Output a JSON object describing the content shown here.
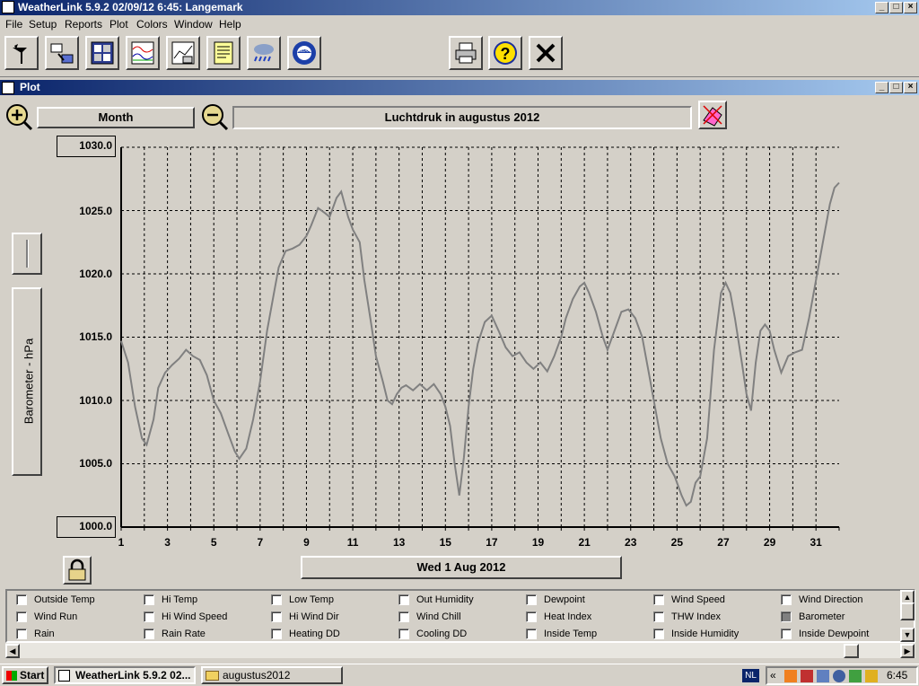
{
  "window": {
    "title": "WeatherLink 5.9.2  02/09/12  6:45: Langemark"
  },
  "menu": [
    "File",
    "Setup",
    "Reports",
    "Plot",
    "Colors",
    "Window",
    "Help"
  ],
  "toolbar": {
    "icons": [
      "station-icon",
      "download-icon",
      "bulletin-icon",
      "strip-chart-icon",
      "plot-icon",
      "summary-icon",
      "rain-icon",
      "noaa-icon",
      "print-icon",
      "help-icon",
      "close-icon"
    ],
    "noaa_label": "NOAA"
  },
  "plot": {
    "window_title": "Plot",
    "span_label": "Month",
    "title": "Luchtdruk in augustus 2012",
    "date_label": "Wed 1 Aug 2012",
    "y_axis_label": "Barometer - hPa",
    "y_max_label": "1030.0",
    "y_min_label": "1000.0",
    "y_ticks": [
      "1025.0",
      "1020.0",
      "1015.0",
      "1010.0",
      "1005.0"
    ],
    "x_ticks": [
      "1",
      "3",
      "5",
      "7",
      "9",
      "11",
      "13",
      "15",
      "17",
      "19",
      "21",
      "23",
      "25",
      "27",
      "29",
      "31"
    ]
  },
  "chart_data": {
    "type": "line",
    "title": "Luchtdruk in augustus 2012",
    "xlabel": "",
    "ylabel": "Barometer - hPa",
    "xlim": [
      1,
      32
    ],
    "ylim": [
      1000,
      1030
    ],
    "grid": true,
    "series": [
      {
        "name": "Barometer",
        "color": "#808080",
        "x": [
          1,
          1.3,
          1.6,
          1.9,
          2.1,
          2.4,
          2.6,
          2.9,
          3.2,
          3.5,
          3.8,
          4.1,
          4.4,
          4.7,
          5.0,
          5.3,
          5.6,
          5.9,
          6.1,
          6.4,
          6.7,
          7.0,
          7.3,
          7.6,
          7.8,
          8.1,
          8.4,
          8.7,
          9.0,
          9.2,
          9.5,
          9.8,
          10.0,
          10.3,
          10.5,
          10.8,
          11.0,
          11.3,
          11.5,
          11.8,
          12.0,
          12.3,
          12.5,
          12.7,
          12.9,
          13.1,
          13.3,
          13.6,
          13.9,
          14.2,
          14.5,
          14.8,
          15.0,
          15.2,
          15.4,
          15.6,
          15.8,
          16.0,
          16.2,
          16.4,
          16.7,
          17.0,
          17.3,
          17.6,
          17.9,
          18.2,
          18.5,
          18.8,
          19.1,
          19.4,
          19.7,
          20.0,
          20.2,
          20.5,
          20.8,
          21.0,
          21.2,
          21.5,
          21.8,
          22.0,
          22.3,
          22.6,
          22.9,
          23.2,
          23.5,
          23.8,
          24.0,
          24.3,
          24.6,
          24.9,
          25.2,
          25.4,
          25.6,
          25.8,
          26.0,
          26.3,
          26.6,
          26.9,
          27.1,
          27.3,
          27.5,
          27.8,
          28.0,
          28.2,
          28.4,
          28.6,
          28.8,
          29.0,
          29.2,
          29.5,
          29.8,
          30.1,
          30.4,
          30.7,
          31.0,
          31.3,
          31.6,
          31.8,
          32.0
        ],
        "y": [
          1014.7,
          1013.0,
          1009.5,
          1007.0,
          1006.5,
          1008.5,
          1011.0,
          1012.2,
          1012.8,
          1013.3,
          1014.0,
          1013.5,
          1013.2,
          1012.0,
          1010.0,
          1009.0,
          1007.5,
          1006.0,
          1005.4,
          1006.2,
          1008.5,
          1011.5,
          1015.5,
          1018.5,
          1020.5,
          1021.8,
          1022.0,
          1022.3,
          1023.0,
          1023.8,
          1025.2,
          1024.8,
          1024.5,
          1026.0,
          1026.5,
          1024.5,
          1023.5,
          1022.5,
          1019.5,
          1016.0,
          1013.5,
          1011.5,
          1010.0,
          1009.7,
          1010.5,
          1011.0,
          1011.2,
          1010.8,
          1011.3,
          1010.8,
          1011.3,
          1010.5,
          1009.5,
          1008.0,
          1005.0,
          1002.5,
          1005.5,
          1009.5,
          1012.5,
          1014.5,
          1016.2,
          1016.7,
          1015.5,
          1014.2,
          1013.5,
          1013.8,
          1013.0,
          1012.5,
          1013.0,
          1012.3,
          1013.5,
          1015.0,
          1016.5,
          1018.0,
          1019.0,
          1019.3,
          1018.5,
          1017.0,
          1015.0,
          1014.0,
          1015.5,
          1017.0,
          1017.2,
          1016.5,
          1015.0,
          1012.0,
          1010.0,
          1007.0,
          1005.0,
          1004.0,
          1002.5,
          1001.7,
          1002.0,
          1003.5,
          1004.0,
          1007.0,
          1014.0,
          1018.5,
          1019.3,
          1018.5,
          1016.5,
          1013.0,
          1010.5,
          1009.2,
          1013.0,
          1015.5,
          1016.0,
          1015.5,
          1014.0,
          1012.2,
          1013.5,
          1013.8,
          1014.0,
          1016.5,
          1019.5,
          1022.5,
          1025.5,
          1026.8,
          1027.2
        ]
      }
    ]
  },
  "legend": {
    "rows": [
      [
        "Outside Temp",
        "Hi Temp",
        "Low Temp",
        "Out Humidity",
        "Dewpoint",
        "Wind Speed",
        "Wind Direction"
      ],
      [
        "Wind Run",
        "Hi Wind Speed",
        "Hi Wind Dir",
        "Wind Chill",
        "Heat Index",
        "THW Index",
        "Barometer"
      ],
      [
        "Rain",
        "Rain Rate",
        "Heating DD",
        "Cooling DD",
        "Inside Temp",
        "Inside Humidity",
        "Inside Dewpoint"
      ]
    ],
    "checked": [
      "Barometer"
    ]
  },
  "taskbar": {
    "start": "Start",
    "task1": "WeatherLink 5.9.2  02...",
    "task2": "augustus2012",
    "lang": "NL",
    "time": "6:45"
  }
}
